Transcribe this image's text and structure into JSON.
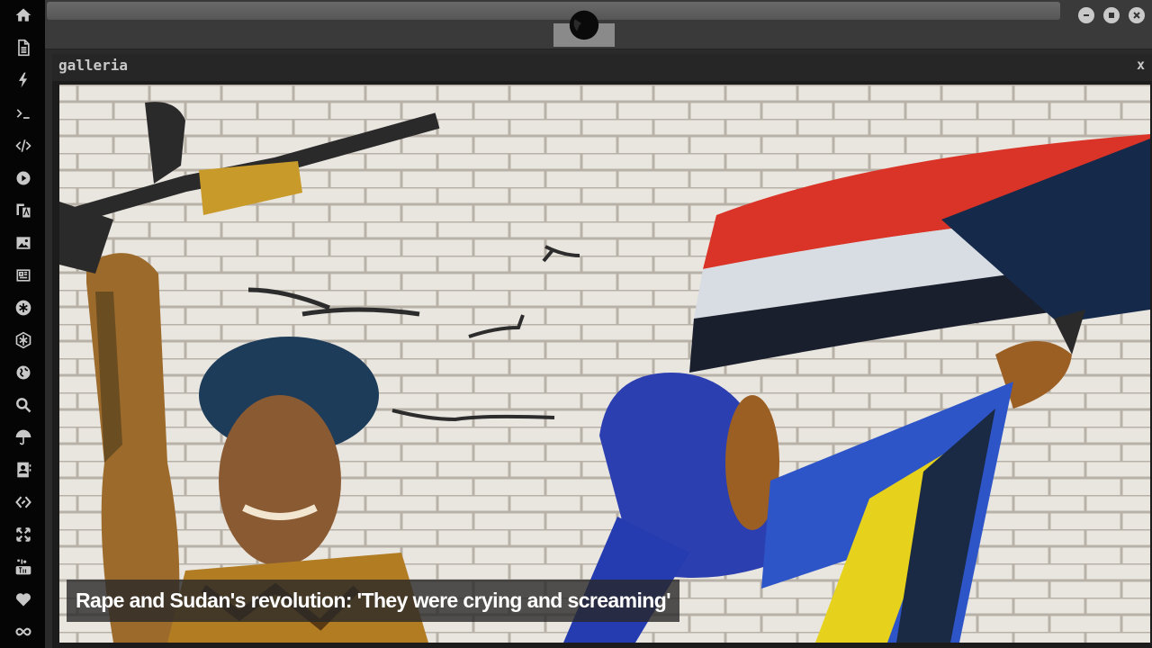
{
  "sidebar": {
    "items": [
      {
        "icon": "home-icon"
      },
      {
        "icon": "document-icon"
      },
      {
        "icon": "lightning-icon"
      },
      {
        "icon": "terminal-icon"
      },
      {
        "icon": "code-icon"
      },
      {
        "icon": "play-icon"
      },
      {
        "icon": "translate-icon"
      },
      {
        "icon": "image-icon"
      },
      {
        "icon": "newspaper-icon"
      },
      {
        "icon": "asterisk-circle-icon"
      },
      {
        "icon": "hexagon-icon"
      },
      {
        "icon": "globe-icon"
      },
      {
        "icon": "search-icon"
      },
      {
        "icon": "umbrella-icon"
      },
      {
        "icon": "contact-icon"
      },
      {
        "icon": "link-icon"
      },
      {
        "icon": "expand-icon"
      },
      {
        "icon": "youtube-icon"
      },
      {
        "icon": "heart-icon"
      },
      {
        "icon": "infinity-icon"
      }
    ]
  },
  "topbar": {
    "logo_icon": "rebel-alliance-icon"
  },
  "gallery": {
    "title": "galleria",
    "close_label": "x",
    "caption": "Rape and Sudan's revolution: 'They were crying and screaming'"
  }
}
